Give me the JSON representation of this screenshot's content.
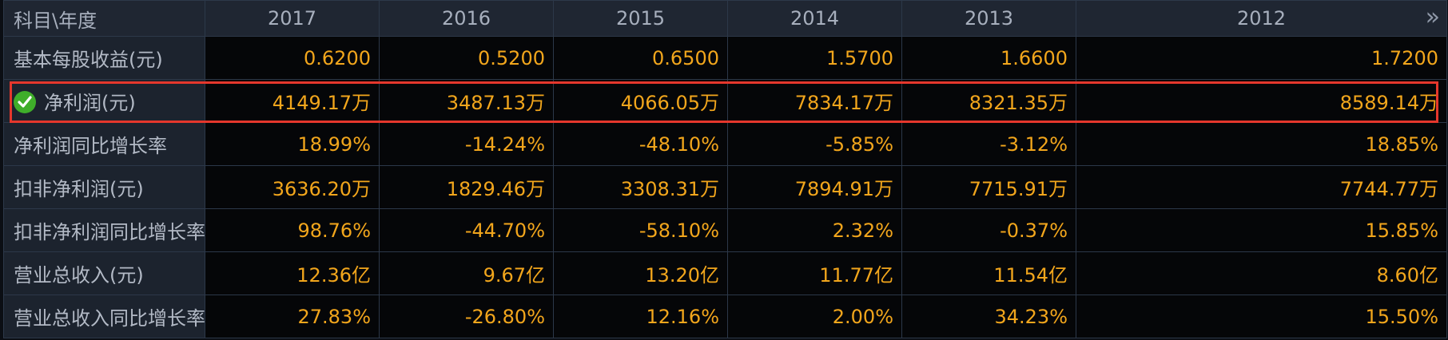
{
  "table": {
    "corner_label": "科目\\年度",
    "years": [
      "2017",
      "2016",
      "2015",
      "2014",
      "2013",
      "2012"
    ],
    "more_icon": "double-chevron-right-icon",
    "rows": [
      {
        "label": "基本每股收益(元)",
        "values": [
          "0.6200",
          "0.5200",
          "0.6500",
          "1.5700",
          "1.6600",
          "1.7200"
        ]
      },
      {
        "label": "净利润(元)",
        "values": [
          "4149.17万",
          "3487.13万",
          "4066.05万",
          "7834.17万",
          "8321.35万",
          "8589.14万"
        ],
        "highlighted": true,
        "icon": "check-circle-icon"
      },
      {
        "label": "净利润同比增长率",
        "values": [
          "18.99%",
          "-14.24%",
          "-48.10%",
          "-5.85%",
          "-3.12%",
          "18.85%"
        ]
      },
      {
        "label": "扣非净利润(元)",
        "values": [
          "3636.20万",
          "1829.46万",
          "3308.31万",
          "7894.91万",
          "7715.91万",
          "7744.77万"
        ]
      },
      {
        "label": "扣非净利润同比增长率",
        "values": [
          "98.76%",
          "-44.70%",
          "-58.10%",
          "2.32%",
          "-0.37%",
          "15.85%"
        ]
      },
      {
        "label": "营业总收入(元)",
        "values": [
          "12.36亿",
          "9.67亿",
          "13.20亿",
          "11.77亿",
          "11.54亿",
          "8.60亿"
        ]
      },
      {
        "label": "营业总收入同比增长率",
        "values": [
          "27.83%",
          "-26.80%",
          "12.16%",
          "2.00%",
          "34.23%",
          "15.50%"
        ]
      }
    ]
  },
  "colors": {
    "value_text": "#f2a61c",
    "highlight_border": "#e5372c",
    "check_icon": "#3fae2a"
  }
}
